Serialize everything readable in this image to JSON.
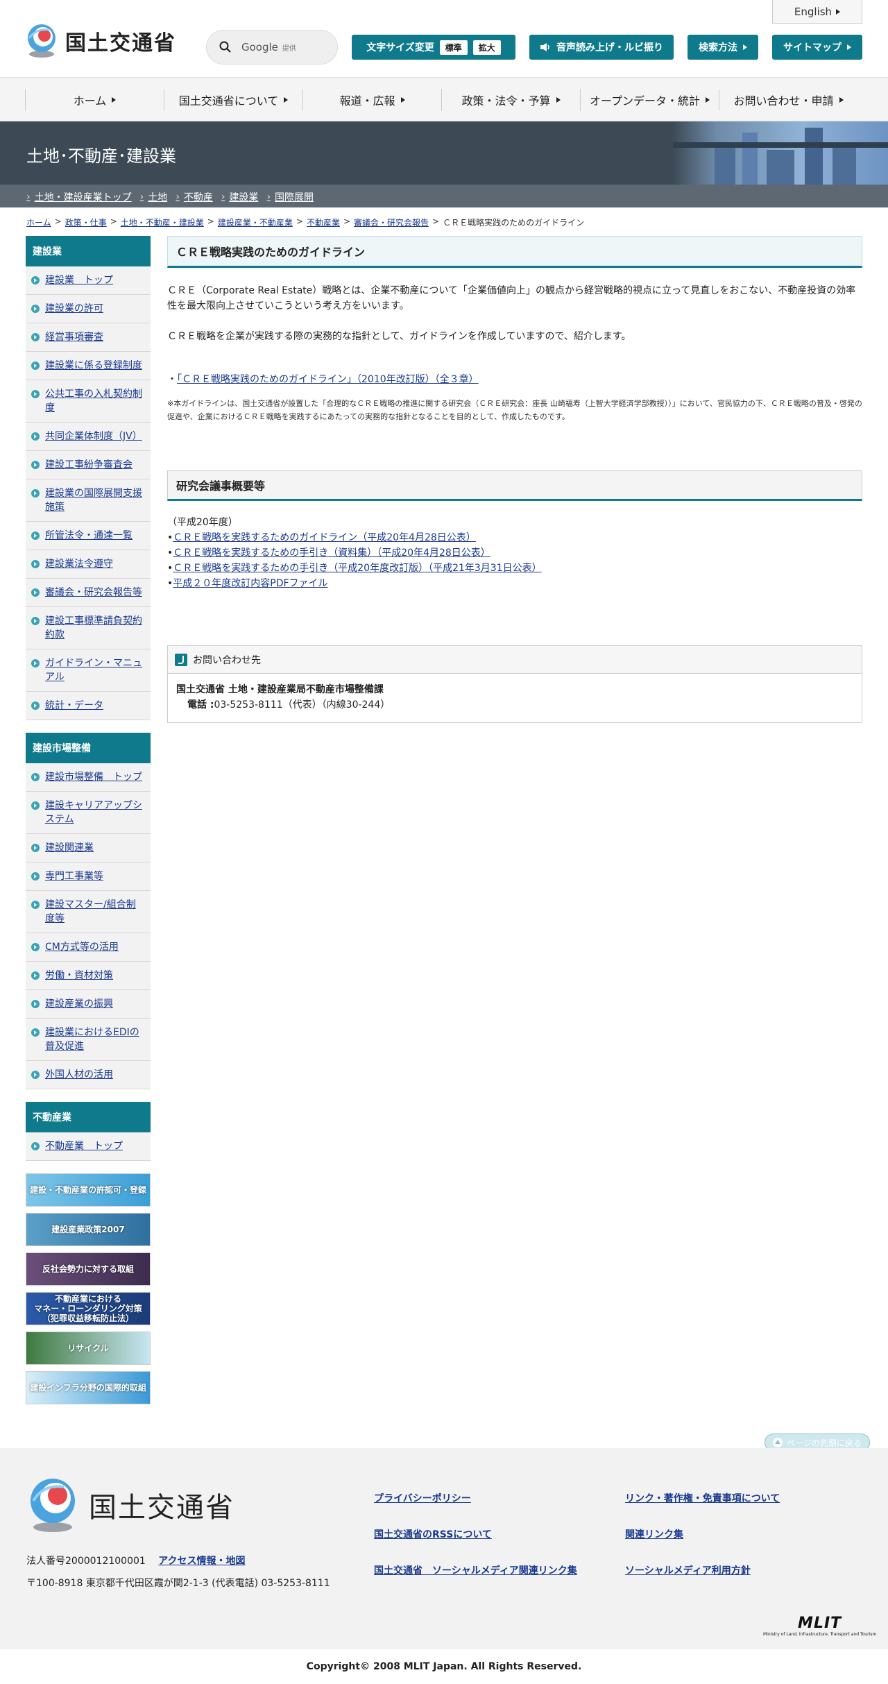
{
  "header": {
    "logo_text": "国土交通省",
    "english": "English",
    "search": {
      "brand": "Google",
      "sub": "提供"
    },
    "font_size": {
      "label": "文字サイズ変更",
      "standard": "標準",
      "large": "拡大"
    },
    "voice": "音声読み上げ・ルビ振り",
    "search_method": "検索方法",
    "sitemap": "サイトマップ"
  },
  "gnav": [
    "ホーム",
    "国土交通省について",
    "報道・広報",
    "政策・法令・予算",
    "オープンデータ・統計",
    "お問い合わせ・申請"
  ],
  "banner": {
    "title": "土地･不動産･建設業"
  },
  "subnav": [
    "土地・建設産業トップ",
    "土地",
    "不動産",
    "建設業",
    "国際展開"
  ],
  "breadcrumb": {
    "links": [
      "ホーム",
      "政策・仕事",
      "土地・不動産・建設業",
      "建設産業・不動産業",
      "不動産業",
      "審議会・研究会報告"
    ],
    "current": "ＣＲＥ戦略実践のためのガイドライン",
    "sep": ">"
  },
  "sidebar": {
    "blocks": [
      {
        "title": "建設業",
        "items": [
          "建設業　トップ",
          "建設業の許可",
          "経営事項審査",
          "建設業に係る登録制度",
          "公共工事の入札契約制度",
          "共同企業体制度（JV）",
          "建設工事紛争審査会",
          "建設業の国際展開支援施策",
          "所管法令・通達一覧",
          "建設業法令遵守",
          "審議会・研究会報告等",
          "建設工事標準請負契約約款",
          "ガイドライン・マニュアル",
          "統計・データ"
        ]
      },
      {
        "title": "建設市場整備",
        "items": [
          "建設市場整備　トップ",
          "建設キャリアアップシステム",
          "建設関連業",
          "専門工事業等",
          "建設マスター/組合制度等",
          "CM方式等の活用",
          "労働・資材対策",
          "建設産業の振興",
          "建設業におけるEDIの普及促進",
          "外国人材の活用"
        ]
      },
      {
        "title": "不動産業",
        "items": [
          "不動産業　トップ"
        ]
      }
    ],
    "banners": [
      {
        "text": "建設・不動産業の許認可・登録",
        "c1": "#7ec6e8",
        "c2": "#3a9fd6"
      },
      {
        "text": "建設産業政策2007",
        "c1": "#5aa0c8",
        "c2": "#2f6f9e"
      },
      {
        "text": "反社会勢力に対する取組",
        "c1": "#6a4f7a",
        "c2": "#3d2c4d"
      },
      {
        "text": "不動産業における\nマネー・ローンダリング対策\n（犯罪収益移転防止法）",
        "c1": "#2b5aa8",
        "c2": "#1b3c78"
      },
      {
        "text": "リサイクル",
        "c1": "#3e7a3e",
        "c2": "#c8e6f4"
      },
      {
        "text": "建設インフラ分野の国際的取組",
        "c1": "#d8eef8",
        "c2": "#3a9ad6"
      }
    ]
  },
  "main": {
    "title": "ＣＲＥ戦略実践のためのガイドライン",
    "para1": "ＣＲＥ（Corporate Real Estate）戦略とは、企業不動産について「企業価値向上」の観点から経営戦略的視点に立って見直しをおこない、不動産投資の効率性を最大限向上させていこうという考え方をいいます。",
    "para2": "ＣＲＥ戦略を企業が実践する際の実務的な指針として、ガイドラインを作成していますので、紹介します。",
    "guideline_prefix": "・",
    "guideline_link": "「ＣＲＥ戦略実践のためのガイドライン」（2010年改訂版）（全３章）",
    "note": "※本ガイドラインは、国土交通省が設置した「合理的なＣＲＥ戦略の推進に関する研究会（ＣＲＥ研究会：座長 山崎福寿（上智大学経済学部教授））」において、官民協力の下、ＣＲＥ戦略の普及・啓発の促進や、企業におけるＣＲＥ戦略を実践するにあたっての実務的な指針となることを目的として、作成したものです。",
    "section_title": "研究会議事概要等",
    "year_note": "（平成20年度）",
    "bullet": "•",
    "links": [
      "ＣＲＥ戦略を実践するためのガイドライン（平成20年4月28日公表）",
      "ＣＲＥ戦略を実践するための手引き（資料集）（平成20年4月28日公表）",
      "ＣＲＥ戦略を実践するための手引き（平成20年度改訂版）（平成21年3月31日公表）",
      "平成２０年度改訂内容PDFファイル"
    ],
    "contact": {
      "head": "お問い合わせ先",
      "org": "国土交通省 土地・建設産業局不動産市場整備課",
      "tel_label": "電話 :",
      "tel": "03-5253-8111（代表）（内線30-244）"
    }
  },
  "totop": "ページの先頭に戻る",
  "footer": {
    "logo_text": "国土交通省",
    "corp_no_label": "法人番号2000012100001",
    "access": "アクセス情報・地図",
    "address": "〒100-8918 東京都千代田区霞が関2-1-3 (代表電話) 03-5253-8111",
    "links": [
      "プライバシーポリシー",
      "リンク・著作権・免責事項について",
      "国土交通省のRSSについて",
      "関連リンク集",
      "国土交通省　ソーシャルメディア関連リンク集",
      "ソーシャルメディア利用方針"
    ],
    "mlit": "MLIT",
    "mlit_sub": "Ministry of Land, Infrastructure, Transport and Tourism",
    "copyright": "Copyright© 2008 MLIT Japan. All Rights Reserved."
  },
  "colors": {
    "accent": "#0e7a8c",
    "banner": "#3d4a55",
    "subnav": "#5d6872",
    "link": "#1a3a8f"
  }
}
